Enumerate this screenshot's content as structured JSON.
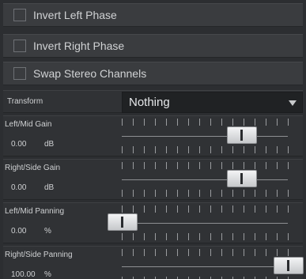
{
  "checkboxes": [
    {
      "label": "Invert Left Phase",
      "checked": false
    },
    {
      "label": "Invert Right Phase",
      "checked": false
    },
    {
      "label": "Swap Stereo Channels",
      "checked": false
    }
  ],
  "transform": {
    "label": "Transform",
    "value": "Nothing",
    "arrow_icon": "chevron-down-icon"
  },
  "sliders": [
    {
      "label": "Left/Mid Gain",
      "value": "0.00",
      "unit": "dB",
      "position": 0.72
    },
    {
      "label": "Right/Side Gain",
      "value": "0.00",
      "unit": "dB",
      "position": 0.72
    },
    {
      "label": "Left/Mid Panning",
      "value": "0.00",
      "unit": "%",
      "position": 0.0
    },
    {
      "label": "Right/Side Panning",
      "value": "100.00",
      "unit": "%",
      "position": 1.0
    }
  ],
  "colors": {
    "panel": "#2c2e31",
    "row": "#3a3c3f",
    "select_bg": "#202224",
    "text": "#d6d8da"
  }
}
